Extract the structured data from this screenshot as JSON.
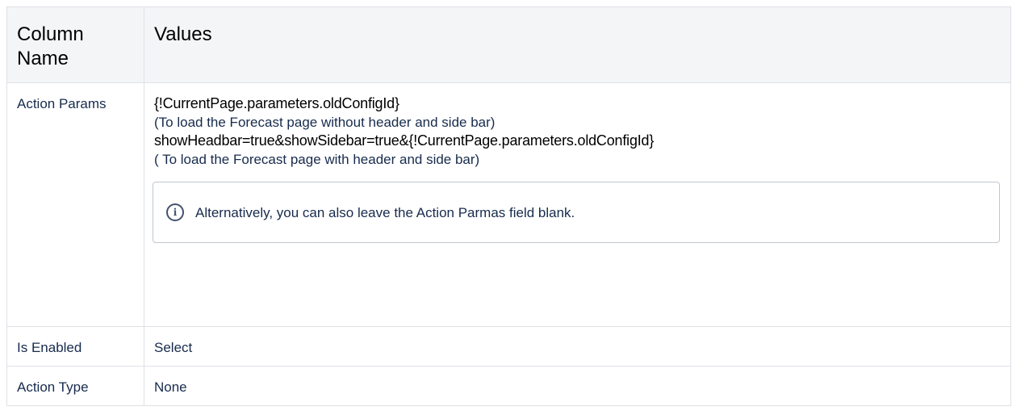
{
  "table": {
    "headers": [
      "Column Name",
      "Values"
    ],
    "rows": [
      {
        "name": "Action Params",
        "lines": [
          "{!CurrentPage.parameters.oldConfigId}",
          "(To load the Forecast page without header and side bar)",
          "showHeadbar=true&showSidebar=true&{!CurrentPage.parameters.oldConfigId}",
          "( To load the Forecast page with header and side bar)"
        ],
        "note": "Alternatively, you can also leave the Action Parmas field blank."
      },
      {
        "name": "Is Enabled",
        "value": "Select"
      },
      {
        "name": "Action Type",
        "value": "None"
      }
    ]
  },
  "icons": {
    "note_icon": "info-icon"
  }
}
